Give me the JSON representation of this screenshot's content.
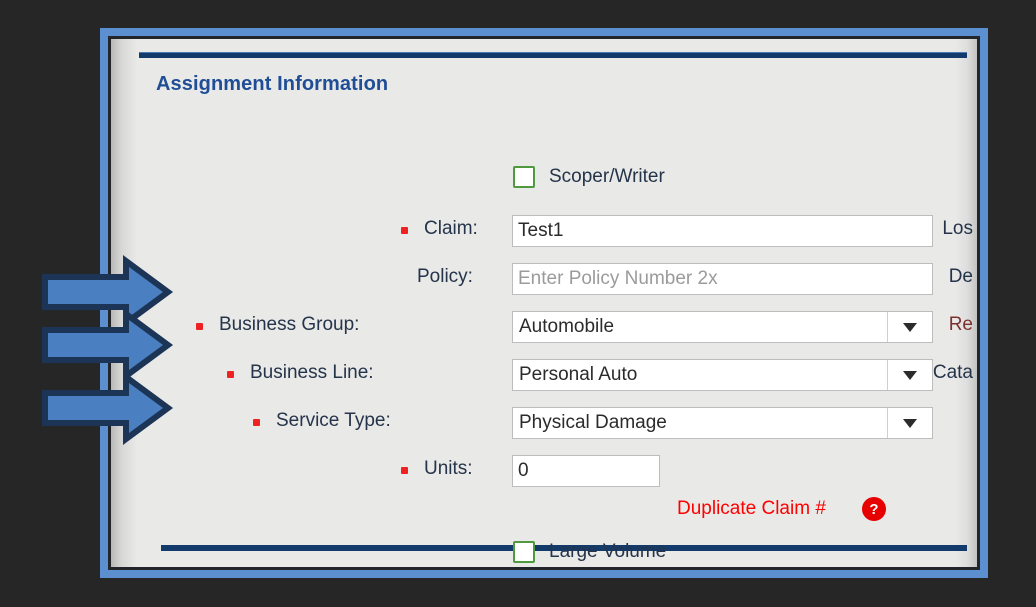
{
  "window": {
    "section_title": "Assignment Information"
  },
  "form": {
    "scoper_writer": {
      "label": "Scoper/Writer",
      "checked": false
    },
    "claim": {
      "label": "Claim:",
      "value": "Test1",
      "required": true
    },
    "policy": {
      "label": "Policy:",
      "value": "",
      "placeholder": "Enter Policy Number 2x",
      "required": false
    },
    "business_group": {
      "label": "Business Group:",
      "value": "Automobile",
      "required": true
    },
    "business_line": {
      "label": "Business Line:",
      "value": "Personal Auto",
      "required": true
    },
    "service_type": {
      "label": "Service Type:",
      "value": "Physical Damage",
      "required": true
    },
    "units": {
      "label": "Units:",
      "value": "0",
      "required": true
    },
    "duplicate_claim": {
      "text": "Duplicate Claim #",
      "help_icon": "question-mark-icon",
      "color": "#fe0000"
    },
    "large_volume": {
      "label": "Large Volume",
      "checked": false
    }
  },
  "right_column": {
    "labels": [
      {
        "text": "Los",
        "clipped": true,
        "warn": false
      },
      {
        "text": "De",
        "clipped": true,
        "warn": false
      },
      {
        "text": "Re",
        "clipped": true,
        "warn": true
      },
      {
        "text": "Cata",
        "clipped": true,
        "warn": false
      }
    ]
  },
  "annotations": {
    "arrows": [
      {
        "name": "arrow-business-group",
        "target": "Business Group"
      },
      {
        "name": "arrow-business-line",
        "target": "Business Line"
      },
      {
        "name": "arrow-service-type",
        "target": "Service Type"
      }
    ],
    "arrow_fill": "#4a7fc1",
    "arrow_stroke": "#1c3556"
  },
  "colors": {
    "page_background": "#262626",
    "window_frame": "#5b8fd0",
    "panel": "#e9e9e7",
    "title": "#1f4e96",
    "rule": "#123a6b",
    "required_marker": "#ee2222",
    "checkbox_border": "#4f9a3f"
  }
}
